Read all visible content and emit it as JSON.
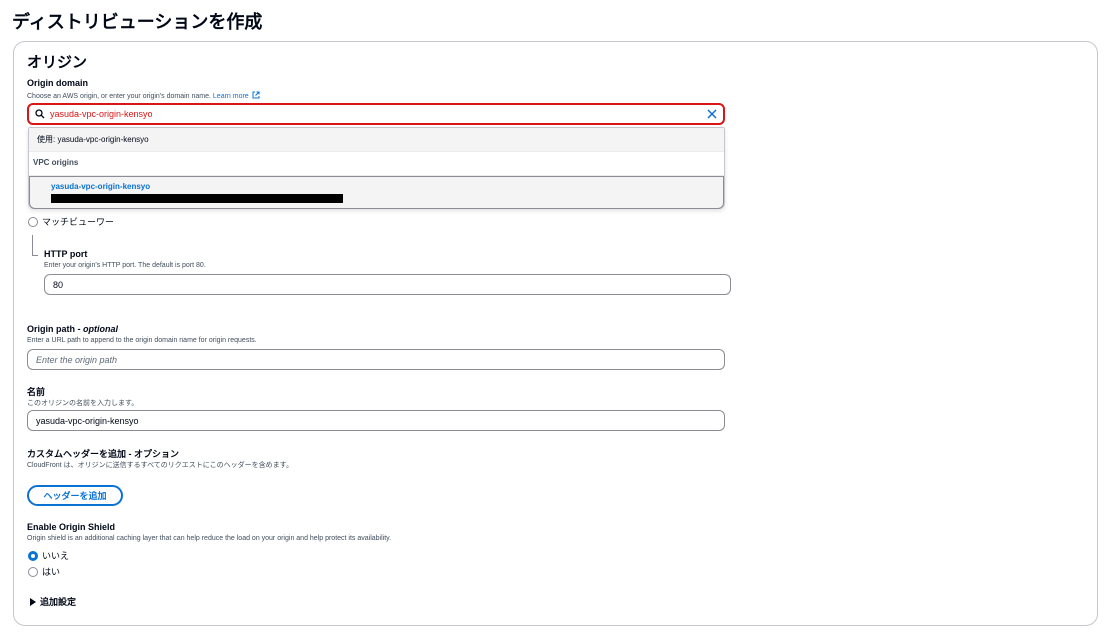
{
  "page": {
    "title": "ディストリビューションを作成"
  },
  "origin_section": {
    "title": "オリジン",
    "origin_domain": {
      "label": "Origin domain",
      "description": "Choose an AWS origin, or enter your origin's domain name.",
      "learn_more": "Learn more",
      "value": "yasuda-vpc-origin-kensyo",
      "dropdown": {
        "use_text": "使用: yasuda-vpc-origin-kensyo",
        "group_label": "VPC origins",
        "option_name": "yasuda-vpc-origin-kensyo"
      }
    },
    "protocol_option_label": "マッチビューワー",
    "http_port": {
      "label": "HTTP port",
      "description": "Enter your origin's HTTP port. The default is port 80.",
      "value": "80"
    },
    "origin_path": {
      "label": "Origin path - ",
      "label_optional": "optional",
      "description": "Enter a URL path to append to the origin domain name for origin requests.",
      "placeholder": "Enter the origin path"
    },
    "name": {
      "label": "名前",
      "description": "このオリジンの名前を入力します。",
      "value": "yasuda-vpc-origin-kensyo"
    },
    "custom_headers": {
      "label": "カスタムヘッダーを追加 - オプション",
      "description": "CloudFront は、オリジンに送信するすべてのリクエストにこのヘッダーを含めます。",
      "button": "ヘッダーを追加"
    },
    "origin_shield": {
      "label": "Enable Origin Shield",
      "description": "Origin shield is an additional caching layer that can help reduce the load on your origin and help protect its availability.",
      "options": [
        "いいえ",
        "はい"
      ],
      "selected": "いいえ"
    },
    "additional_settings": "追加設定"
  },
  "icons": {
    "search": "search-icon",
    "clear": "close-icon",
    "external": "external-link-icon",
    "expand": "caret-right-icon"
  },
  "colors": {
    "error": "#d91515",
    "accent": "#0972d3",
    "text": "#000716",
    "border": "#8c8c94"
  }
}
